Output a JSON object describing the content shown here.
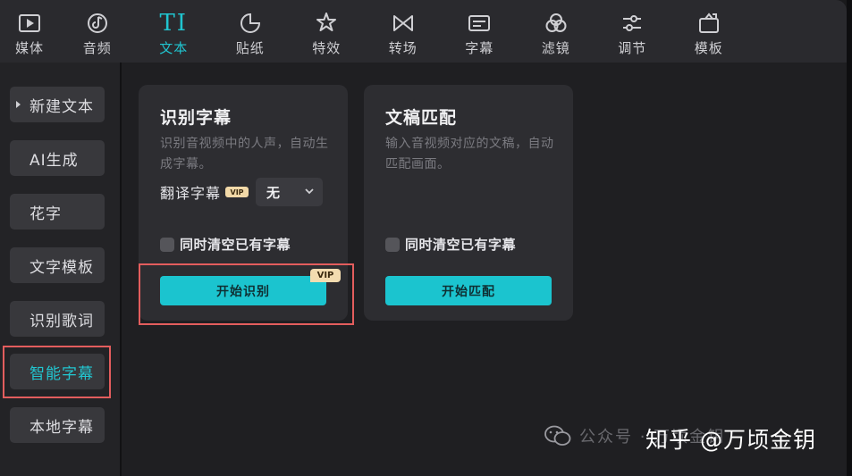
{
  "toolbar": {
    "items": [
      {
        "label": "媒体",
        "icon": "media-icon"
      },
      {
        "label": "音频",
        "icon": "audio-icon"
      },
      {
        "label": "文本",
        "icon": "text-icon",
        "glyph": "TI",
        "active": true
      },
      {
        "label": "贴纸",
        "icon": "sticker-icon"
      },
      {
        "label": "特效",
        "icon": "effects-icon"
      },
      {
        "label": "转场",
        "icon": "transition-icon"
      },
      {
        "label": "字幕",
        "icon": "subtitle-icon"
      },
      {
        "label": "滤镜",
        "icon": "filter-icon"
      },
      {
        "label": "调节",
        "icon": "adjust-icon"
      },
      {
        "label": "模板",
        "icon": "template-icon"
      }
    ]
  },
  "sidebar": {
    "items": [
      {
        "label": "新建文本"
      },
      {
        "label": "AI生成"
      },
      {
        "label": "花字"
      },
      {
        "label": "文字模板"
      },
      {
        "label": "识别歌词"
      },
      {
        "label": "智能字幕",
        "active": true
      },
      {
        "label": "本地字幕"
      }
    ]
  },
  "cards": {
    "recognize": {
      "title": "识别字幕",
      "desc": "识别音视频中的人声，自动生成字幕。",
      "translate_label": "翻译字幕",
      "vip_badge": "VIP",
      "translate_value": "无",
      "clear_label": "同时清空已有字幕",
      "button": "开始识别",
      "button_badge": "VIP"
    },
    "match": {
      "title": "文稿匹配",
      "desc": "输入音视频对应的文稿，自动匹配画面。",
      "clear_label": "同时清空已有字幕",
      "button": "开始匹配"
    }
  },
  "watermark": {
    "faded": "公众号 · 万顷金钥",
    "main": "知乎 @万顷金钥"
  },
  "colors": {
    "accent": "#1bc4cf",
    "highlight": "#e35d5d",
    "vip": "#f3dcb0"
  }
}
